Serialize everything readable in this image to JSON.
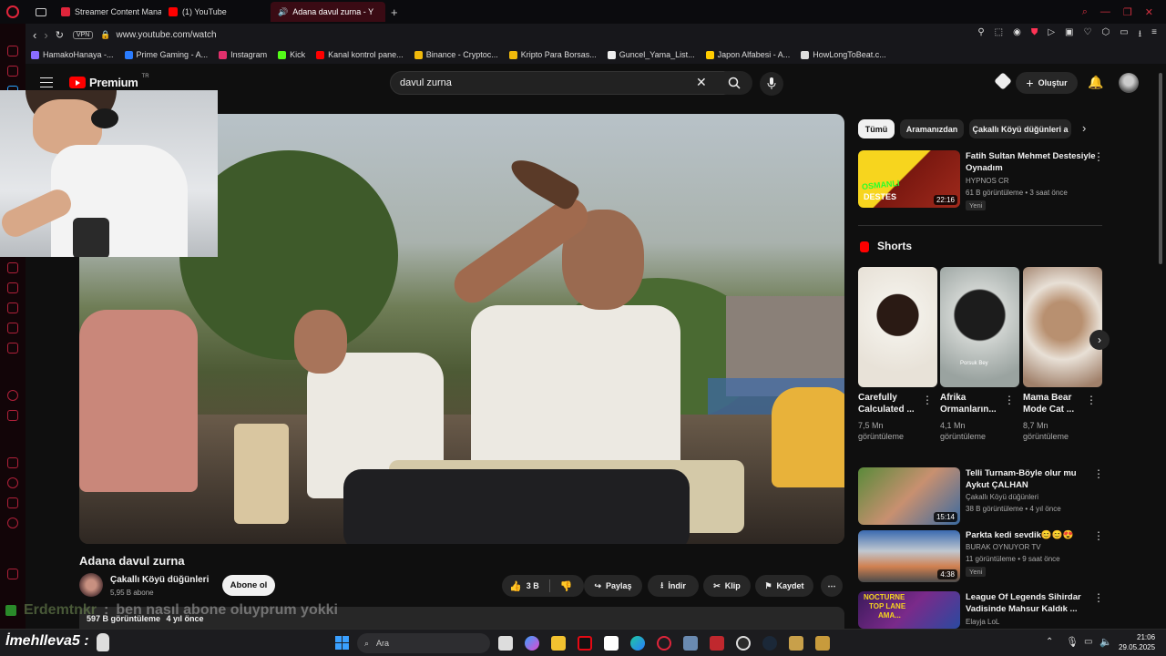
{
  "browser": {
    "tabs": [
      {
        "label": "Streamer Content Manag",
        "active": false
      },
      {
        "label": "(1) YouTube",
        "active": false
      },
      {
        "label": "Adana davul zurna - Y",
        "active": true
      }
    ],
    "url_badge": "VPN",
    "url": "www.youtube.com/watch",
    "bookmarks": [
      "HamakoHanaya -...",
      "Prime Gaming - A...",
      "Instagram",
      "Kick",
      "Kanal kontrol pane...",
      "Binance - Cryptoc...",
      "Kripto Para Borsas...",
      "Guncel_Yama_List...",
      "Japon Alfabesi - A...",
      "HowLongToBeat.c..."
    ]
  },
  "youtube": {
    "logo": "Premium",
    "logo_region": "TR",
    "search_value": "davul zurna",
    "create_label": "Oluştur",
    "video": {
      "title": "Adana davul zurna",
      "channel": "Çakallı Köyü düğünleri",
      "subs": "5,95 B abone",
      "subscribe_label": "Abone ol",
      "likes": "3 B",
      "share_label": "Paylaş",
      "download_label": "İndir",
      "clip_label": "Klip",
      "save_label": "Kaydet",
      "views": "597 B görüntüleme",
      "age": "4 yıl önce"
    },
    "chips": [
      "Tümü",
      "Aramanızdan",
      "Çakallı Köyü düğünleri a"
    ],
    "recommended": [
      {
        "title1": "Fatih Sultan Mehmet Destesiyle",
        "title2": "Oynadım",
        "channel": "HYPNOS CR",
        "meta": "61 B görüntüleme • 3 saat önce",
        "badge": "Yeni",
        "duration": "22:16",
        "thumb_text1": "OSMANLI",
        "thumb_text2": "DESTES"
      },
      {
        "title1": "Telli Turnam-Böyle olur mu",
        "title2": "Aykut ÇALHAN",
        "channel": "Çakallı Köyü düğünleri",
        "meta": "38 B görüntüleme • 4 yıl önce",
        "duration": "15:14"
      },
      {
        "title1": "Parkta kedi sevdik😊😊😍",
        "channel": "BURAK OYNUYOR TV",
        "meta": "11 görüntüleme • 9 saat önce",
        "badge": "Yeni",
        "duration": "4:38"
      },
      {
        "title1": "League Of Legends Sihirdar",
        "title2": "Vadisinde Mahsur Kaldık ...",
        "channel": "Elayja LoL",
        "thumb_text1": "NOCTURNE",
        "thumb_text2": "TOP LANE",
        "thumb_text3": "AMA..."
      }
    ],
    "shorts_label": "Shorts",
    "shorts": [
      {
        "title1": "Carefully",
        "title2": "Calculated ...",
        "views1": "7,5 Mn",
        "views2": "görüntüleme"
      },
      {
        "title1": "Afrika",
        "title2": "Ormanların...",
        "views1": "4,1 Mn",
        "views2": "görüntüleme",
        "thumb_text": "Porsuk Bey"
      },
      {
        "title1": "Mama Bear",
        "title2": "Mode Cat ...",
        "views1": "8,7 Mn",
        "views2": "görüntüleme"
      }
    ]
  },
  "chat_overlay": {
    "user": "Erdemtnkr",
    "message": "ben nasıl abone oluyprum yokki"
  },
  "streamer_tag": "İmehlleva5 :",
  "taskbar": {
    "search_placeholder": "Ara",
    "time": "21:06",
    "date": "29.05.2025"
  },
  "colors": {
    "accent_red": "#ff0000",
    "browser_accent": "#e0253b"
  }
}
